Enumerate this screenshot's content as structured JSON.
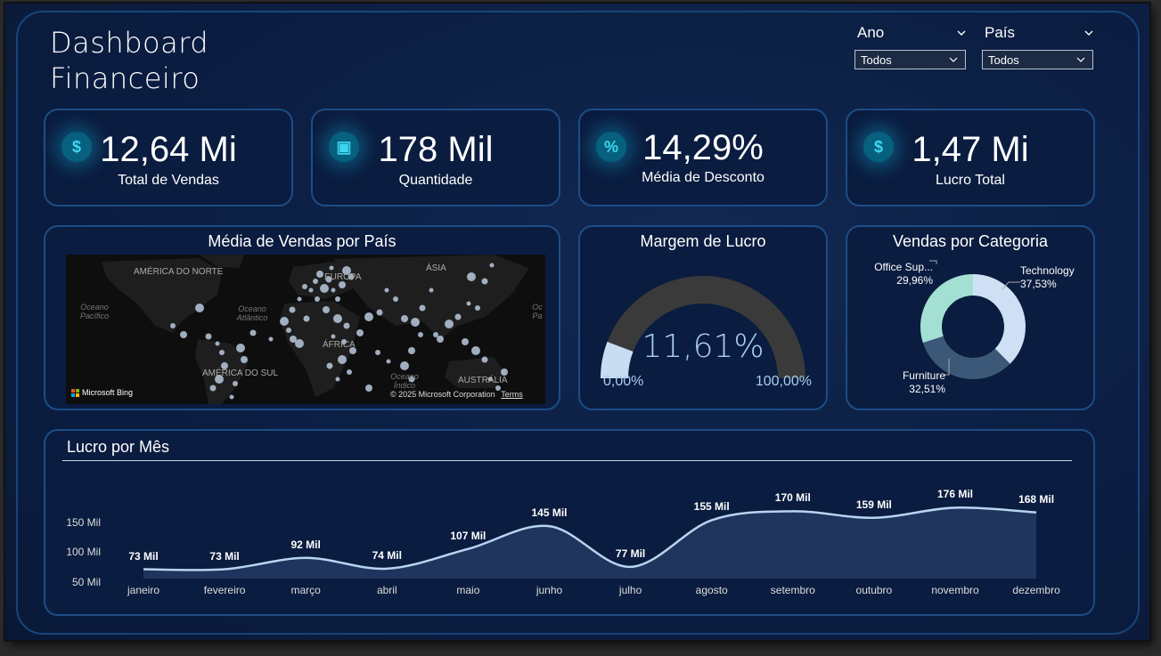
{
  "title": {
    "line1": "Dashboard",
    "line2": "Financeiro"
  },
  "filters": [
    {
      "label": "Ano",
      "value": "Todos"
    },
    {
      "label": "País",
      "value": "Todos"
    }
  ],
  "kpis": [
    {
      "value": "12,64 Mi",
      "caption": "Total de Vendas",
      "icon": "dollar-icon",
      "glyph": "$"
    },
    {
      "value": "178 Mil",
      "caption": "Quantidade",
      "icon": "cup-icon",
      "glyph": "▣"
    },
    {
      "value": "14,29%",
      "caption": "Média de Desconto",
      "icon": "percent-icon",
      "glyph": "%"
    },
    {
      "value": "1,47 Mi",
      "caption": "Lucro Total",
      "icon": "money-bag-icon",
      "glyph": "$"
    }
  ],
  "map": {
    "title": "Média de Vendas por País",
    "labels": {
      "na": "AMÉRICA DO NORTE",
      "sa": "AMÉRICA DO SUL",
      "eu": "EUROPA",
      "af": "ÁFRICA",
      "as": "ÁSIA",
      "au": "AUSTRÁLIA"
    },
    "oceans": {
      "pac": "Oceano Pacífico",
      "atl": "Oceano Atlântico",
      "ind": "Oceano Índico",
      "pac2": "Oc Pa"
    },
    "bing": "Microsoft Bing",
    "copyright": "© 2025 Microsoft Corporation",
    "terms": "Terms"
  },
  "gauge": {
    "title": "Margem de Lucro",
    "value": 11.61,
    "value_label": "11,61%",
    "min_label": "0,00%",
    "max_label": "100,00%",
    "min": 0,
    "max": 100,
    "fill_color": "#c8dcf2",
    "track_color": "#3a3a3a"
  },
  "donut": {
    "title": "Vendas por Categoria",
    "segments": [
      {
        "name": "Technology",
        "short": "Technology",
        "pct": "37,53%",
        "value": 37.53,
        "color": "#cfe0f5"
      },
      {
        "name": "Furniture",
        "short": "Furniture",
        "pct": "32,51%",
        "value": 32.51,
        "color": "#3c5878"
      },
      {
        "name": "Office Supplies",
        "short": "Office Sup...",
        "pct": "29,96%",
        "value": 29.96,
        "color": "#a3e0d3"
      }
    ]
  },
  "chart_data": {
    "type": "area",
    "title": "Lucro por Mês",
    "categories": [
      "janeiro",
      "fevereiro",
      "março",
      "abril",
      "maio",
      "junho",
      "julho",
      "agosto",
      "setembro",
      "outubro",
      "novembro",
      "dezembro"
    ],
    "values": [
      73,
      73,
      92,
      74,
      107,
      145,
      77,
      155,
      170,
      159,
      176,
      168
    ],
    "value_labels": [
      "73 Mil",
      "73 Mil",
      "92 Mil",
      "74 Mil",
      "107 Mil",
      "145 Mil",
      "77 Mil",
      "155 Mil",
      "170 Mil",
      "159 Mil",
      "176 Mil",
      "168 Mil"
    ],
    "yticks": [
      "50 Mil",
      "100 Mil",
      "150 Mil"
    ],
    "ytick_values": [
      50,
      100,
      150
    ],
    "unit": "Mil",
    "line_color": "#b9d4f1"
  }
}
